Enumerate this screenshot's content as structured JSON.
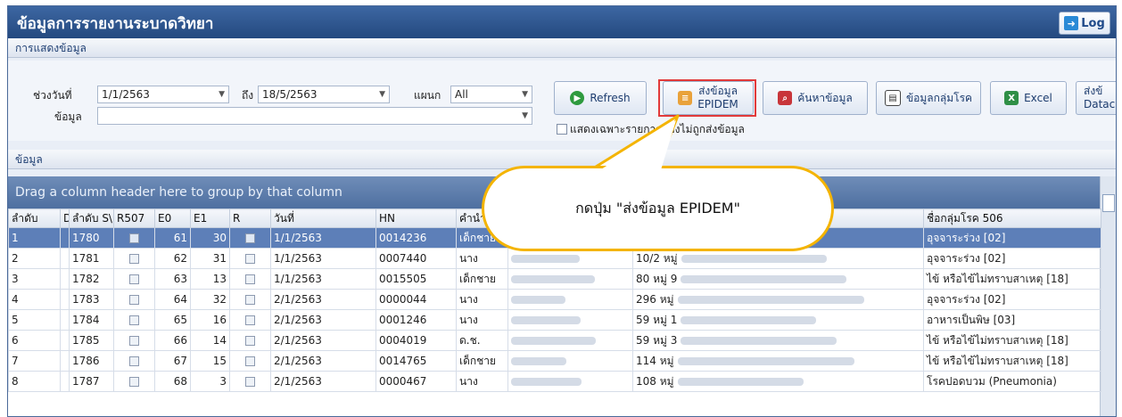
{
  "window": {
    "title": "ข้อมูลการรายงานระบาดวิทยา",
    "log_label": "Log"
  },
  "sections": {
    "display": "การแสดงข้อมูล",
    "data": "ข้อมูล"
  },
  "filters": {
    "date_range_label": "ช่วงวันที่",
    "date_from": "1/1/2563",
    "to_label": "ถึง",
    "date_to": "18/5/2563",
    "dept_label": "แผนก",
    "dept_value": "All",
    "data_label": "ข้อมูล",
    "data_value": "",
    "only_unsent_label": "แสดงเฉพาะรายการที่ยังไม่ถูกส่งข้อมูล"
  },
  "toolbar": {
    "refresh": "Refresh",
    "send_line1": "ส่งข้อมูล",
    "send_line2": "EPIDEM",
    "search": "ค้นหาข้อมูล",
    "disease_group": "ข้อมูลกลุ่มโรค",
    "excel": "Excel",
    "datacenter_line1": "ส่งข้",
    "datacenter_line2": "Datac"
  },
  "grid": {
    "group_hint": "Drag a column header here to group by that column",
    "columns": [
      "ลำดับ",
      "D",
      "ลำดับ S\\",
      "R507",
      "E0",
      "E1",
      "R",
      "วันที่",
      "HN",
      "คำนำ",
      "",
      "",
      "ชื่อกลุ่มโรค 506"
    ],
    "rows": [
      {
        "no": "1",
        "seq": "1780",
        "e0": "61",
        "e1": "30",
        "date": "1/1/2563",
        "hn": "0014236",
        "prefix": "เด็กชาย",
        "addr": "",
        "group": "อุจจาระร่วง [02]"
      },
      {
        "no": "2",
        "seq": "1781",
        "e0": "62",
        "e1": "31",
        "date": "1/1/2563",
        "hn": "0007440",
        "prefix": "นาง",
        "addr": "10/2 หมู่",
        "group": "อุจจาระร่วง [02]"
      },
      {
        "no": "3",
        "seq": "1782",
        "e0": "63",
        "e1": "13",
        "date": "1/1/2563",
        "hn": "0015505",
        "prefix": "เด็กชาย",
        "addr": "80 หมู่ 9",
        "group": "ไข้ หรือไข้ไม่ทราบสาเหตุ [18]"
      },
      {
        "no": "4",
        "seq": "1783",
        "e0": "64",
        "e1": "32",
        "date": "2/1/2563",
        "hn": "0000044",
        "prefix": "นาง",
        "addr": "296 หมู่",
        "group": "อุจจาระร่วง [02]"
      },
      {
        "no": "5",
        "seq": "1784",
        "e0": "65",
        "e1": "16",
        "date": "2/1/2563",
        "hn": "0001246",
        "prefix": "นาง",
        "addr": "59 หมู่ 1",
        "group": "อาหารเป็นพิษ [03]"
      },
      {
        "no": "6",
        "seq": "1785",
        "e0": "66",
        "e1": "14",
        "date": "2/1/2563",
        "hn": "0004019",
        "prefix": "ด.ช.",
        "addr": "59 หมู่ 3",
        "group": "ไข้ หรือไข้ไม่ทราบสาเหตุ [18]"
      },
      {
        "no": "7",
        "seq": "1786",
        "e0": "67",
        "e1": "15",
        "date": "2/1/2563",
        "hn": "0014765",
        "prefix": "เด็กชาย",
        "addr": "114 หมู่",
        "group": "ไข้ หรือไข้ไม่ทราบสาเหตุ [18]"
      },
      {
        "no": "8",
        "seq": "1787",
        "e0": "68",
        "e1": "3",
        "date": "2/1/2563",
        "hn": "0000467",
        "prefix": "นาง",
        "addr": "108 หมู่",
        "group": "โรคปอดบวม (Pneumonia)"
      }
    ]
  },
  "callout": {
    "text": "กดปุ่ม \"ส่งข้อมูล EPIDEM\""
  },
  "colors": {
    "titlebar": "#2b5591",
    "highlight": "#e23a3a",
    "callout_border": "#f4b400"
  }
}
